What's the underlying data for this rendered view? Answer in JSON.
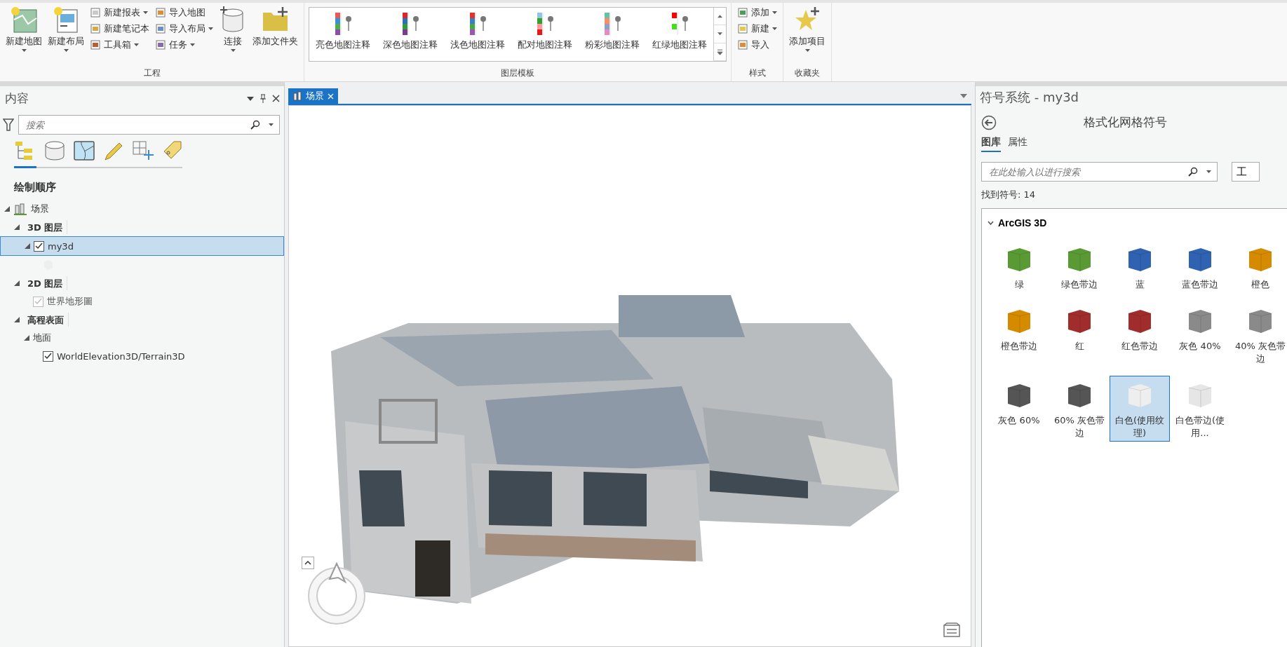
{
  "ribbon": {
    "groups": [
      {
        "label": "工程",
        "kind": "buttons",
        "items": [
          {
            "kind": "large",
            "label": "新建地图",
            "dropdown": true
          },
          {
            "kind": "large",
            "label": "新建布局",
            "dropdown": true
          },
          {
            "kind": "stack",
            "items": [
              {
                "label": "新建报表",
                "dropdown": true
              },
              {
                "label": "新建笔记本",
                "dropdown": false
              },
              {
                "label": "工具箱",
                "dropdown": true
              }
            ]
          },
          {
            "kind": "stack",
            "items": [
              {
                "label": "导入地图",
                "dropdown": false
              },
              {
                "label": "导入布局",
                "dropdown": true
              },
              {
                "label": "任务",
                "dropdown": true
              }
            ]
          },
          {
            "kind": "large",
            "label": "连接",
            "dropdown": true
          },
          {
            "kind": "large",
            "label": "添加文件夹",
            "dropdown": false
          }
        ]
      },
      {
        "label": "图层模板",
        "kind": "gallery",
        "items": [
          {
            "label": "亮色地图注释"
          },
          {
            "label": "深色地图注释"
          },
          {
            "label": "浅色地图注释"
          },
          {
            "label": "配对地图注释"
          },
          {
            "label": "粉彩地图注释"
          },
          {
            "label": "红绿地图注释"
          }
        ]
      },
      {
        "label": "样式",
        "kind": "buttons",
        "items": [
          {
            "kind": "stack",
            "items": [
              {
                "label": "添加",
                "dropdown": true
              },
              {
                "label": "新建",
                "dropdown": true
              },
              {
                "label": "导入",
                "dropdown": false
              }
            ]
          }
        ]
      },
      {
        "label": "收藏夹",
        "kind": "buttons",
        "items": [
          {
            "kind": "large",
            "label": "添加项目",
            "dropdown": true
          }
        ]
      }
    ]
  },
  "contents": {
    "title": "内容",
    "search": {
      "placeholder": "搜索"
    },
    "view_tabs": [
      {
        "selected": true
      },
      {
        "selected": false
      },
      {
        "selected": false
      },
      {
        "selected": false
      },
      {
        "selected": false
      },
      {
        "selected": false
      }
    ],
    "heading": "绘制顺序",
    "tree": [
      {
        "kind": "scene",
        "label": "场景",
        "expanded": true,
        "children": [
          {
            "kind": "group",
            "label": "3D 图层",
            "expanded": true,
            "children": [
              {
                "kind": "layer",
                "label": "my3d",
                "expanded": true,
                "checked": true,
                "disabled": false,
                "selected": true,
                "children": [
                  {
                    "kind": "symbol"
                  }
                ]
              }
            ]
          },
          {
            "kind": "group",
            "label": "2D 图层",
            "expanded": true,
            "children": [
              {
                "kind": "layer",
                "label": "世界地形圖",
                "checked": true,
                "disabled": true,
                "selected": false
              }
            ]
          },
          {
            "kind": "group",
            "label": "高程表面",
            "expanded": true,
            "children": [
              {
                "kind": "sublayer",
                "label": "地面",
                "expanded": true,
                "children": [
                  {
                    "kind": "layer",
                    "label": "WorldElevation3D/Terrain3D",
                    "checked": true,
                    "disabled": false,
                    "selected": false
                  }
                ]
              }
            ]
          }
        ]
      }
    ]
  },
  "view": {
    "tabs": [
      {
        "label": "场景",
        "selected": true
      }
    ]
  },
  "symbology": {
    "title": "符号系统 - my3d",
    "heading": "格式化网格符号",
    "tabs": [
      {
        "label": "图库",
        "selected": true
      },
      {
        "label": "属性",
        "selected": false
      }
    ],
    "search": {
      "placeholder": "在此处输入以进行搜索"
    },
    "scope": "工",
    "count": "找到符号: 14",
    "group": {
      "label": "ArcGIS 3D",
      "expanded": true,
      "items": [
        {
          "label": "绿",
          "color": "#5a9a35",
          "selected": false
        },
        {
          "label": "绿色带边",
          "color": "#5a9a35",
          "selected": false
        },
        {
          "label": "蓝",
          "color": "#2f62b0",
          "selected": false
        },
        {
          "label": "蓝色带边",
          "color": "#2f62b0",
          "selected": false
        },
        {
          "label": "橙色",
          "color": "#d68a00",
          "selected": false
        },
        {
          "label": "橙色带边",
          "color": "#d68a00",
          "selected": false
        },
        {
          "label": "红",
          "color": "#a02c2c",
          "selected": false
        },
        {
          "label": "红色带边",
          "color": "#a02c2c",
          "selected": false
        },
        {
          "label": "灰色 40%",
          "color": "#8a8a8a",
          "selected": false
        },
        {
          "label": "40% 灰色带边",
          "color": "#8a8a8a",
          "selected": false
        },
        {
          "label": "灰色 60%",
          "color": "#555555",
          "selected": false
        },
        {
          "label": "60% 灰色带边",
          "color": "#555555",
          "selected": false
        },
        {
          "label": "白色(使用纹理)",
          "color": "#eeeeee",
          "selected": true
        },
        {
          "label": "白色带边(使用...",
          "color": "#e6e6e6",
          "selected": false
        }
      ]
    }
  }
}
